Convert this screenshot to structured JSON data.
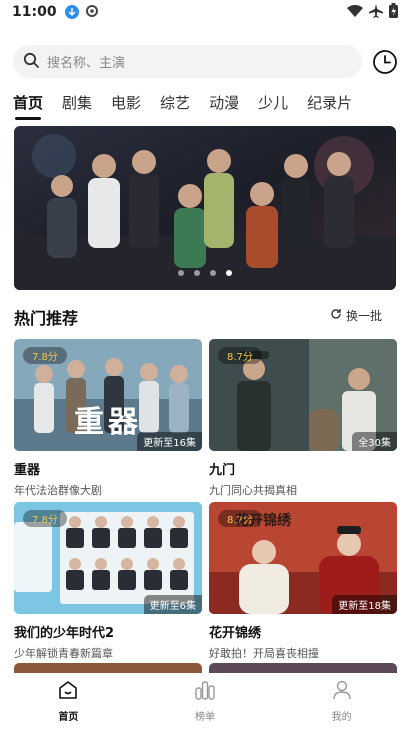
{
  "status": {
    "time": "11:00"
  },
  "search": {
    "placeholder": "搜名称、主演"
  },
  "tabs": [
    {
      "label": "首页"
    },
    {
      "label": "剧集"
    },
    {
      "label": "电影"
    },
    {
      "label": "综艺"
    },
    {
      "label": "动漫"
    },
    {
      "label": "少儿"
    },
    {
      "label": "纪录片"
    }
  ],
  "section": {
    "title": "热门推荐",
    "refresh_label": "换一批"
  },
  "cards": [
    {
      "title": "重器",
      "subtitle": "年代法治群像大剧",
      "score": "7.8分",
      "episodes": "更新至16集",
      "poster_text": "重器",
      "colors": [
        "#7fa3b8",
        "#4c6a7d"
      ]
    },
    {
      "title": "九门",
      "subtitle": "九门同心共揭真相",
      "score": "8.7分",
      "episodes": "全30集",
      "poster_text": "",
      "colors": [
        "#5a6d6e",
        "#2e3a3c"
      ]
    },
    {
      "title": "我们的少年时代2",
      "subtitle": "少年解锁青春新篇章",
      "score": "7.8分",
      "episodes": "更新至6集",
      "poster_text": "",
      "colors": [
        "#8fd0e8",
        "#4ea9d6"
      ]
    },
    {
      "title": "花开锦绣",
      "subtitle": "好敢拍！开局喜丧相撞",
      "score": "8.2分",
      "episodes": "更新至18集",
      "poster_text": "花开锦绣",
      "colors": [
        "#c24a36",
        "#7d1f1a"
      ]
    }
  ],
  "nav": [
    {
      "label": "首页",
      "active": true
    },
    {
      "label": "榜单",
      "active": false
    },
    {
      "label": "我的",
      "active": false
    }
  ],
  "colors": {
    "score": "#f3c64a",
    "accent": "#111111",
    "search_bg": "#f2f3f5"
  }
}
